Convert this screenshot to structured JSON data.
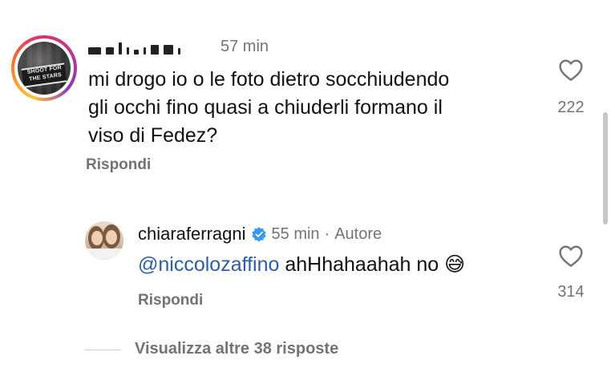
{
  "comment": {
    "time": "57 min",
    "text_lines": [
      "mi drogo io o le foto dietro socchiudendo",
      "gli occhi fino quasi a chiuderli formano il",
      "viso di Fedez?"
    ],
    "reply_label": "Rispondi",
    "like_count": "222",
    "avatar_text": "SHOOT FOR THE STARS"
  },
  "reply": {
    "username": "chiaraferragni",
    "time": "55 min",
    "separator": "·",
    "author_badge": "Autore",
    "mention": "@niccolozaffino",
    "text": " ahHhahaahah no ",
    "emoji": "😅",
    "reply_label": "Rispondi",
    "like_count": "314"
  },
  "view_more": "Visualizza altre 38 risposte",
  "colors": {
    "text": "#111111",
    "secondary": "#737373",
    "mention": "#2b5ea7",
    "verified": "#3897f0"
  },
  "icons": [
    "heart-icon",
    "verified-badge-icon"
  ]
}
